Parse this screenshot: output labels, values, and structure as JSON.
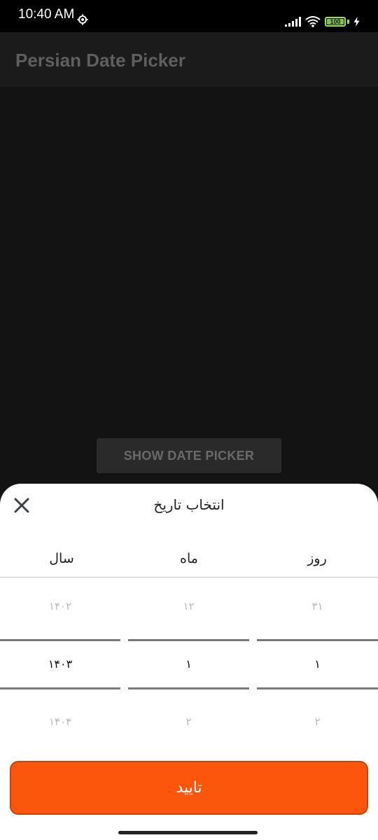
{
  "status_bar": {
    "time": "10:40 AM",
    "battery_level": "100",
    "icons": [
      "gear-icon",
      "signal-icon",
      "wifi-icon",
      "battery-icon",
      "charging-icon"
    ]
  },
  "app_bar": {
    "title": "Persian Date Picker"
  },
  "main": {
    "show_button_label": "SHOW DATE PICKER"
  },
  "sheet": {
    "title": "انتخاب تاریخ",
    "columns": {
      "year": {
        "header": "سال",
        "prev": "۱۴۰۲",
        "selected": "۱۴۰۳",
        "next": "۱۴۰۴"
      },
      "month": {
        "header": "ماه",
        "prev": "۱۲",
        "selected": "۱",
        "next": "۲"
      },
      "day": {
        "header": "روز",
        "prev": "۳۱",
        "selected": "۱",
        "next": "۲"
      }
    },
    "confirm_label": "تایید"
  },
  "colors": {
    "accent": "#fb560c",
    "background": "#131313",
    "app_bar": "#1b1b1b",
    "battery": "#7cc83a"
  }
}
